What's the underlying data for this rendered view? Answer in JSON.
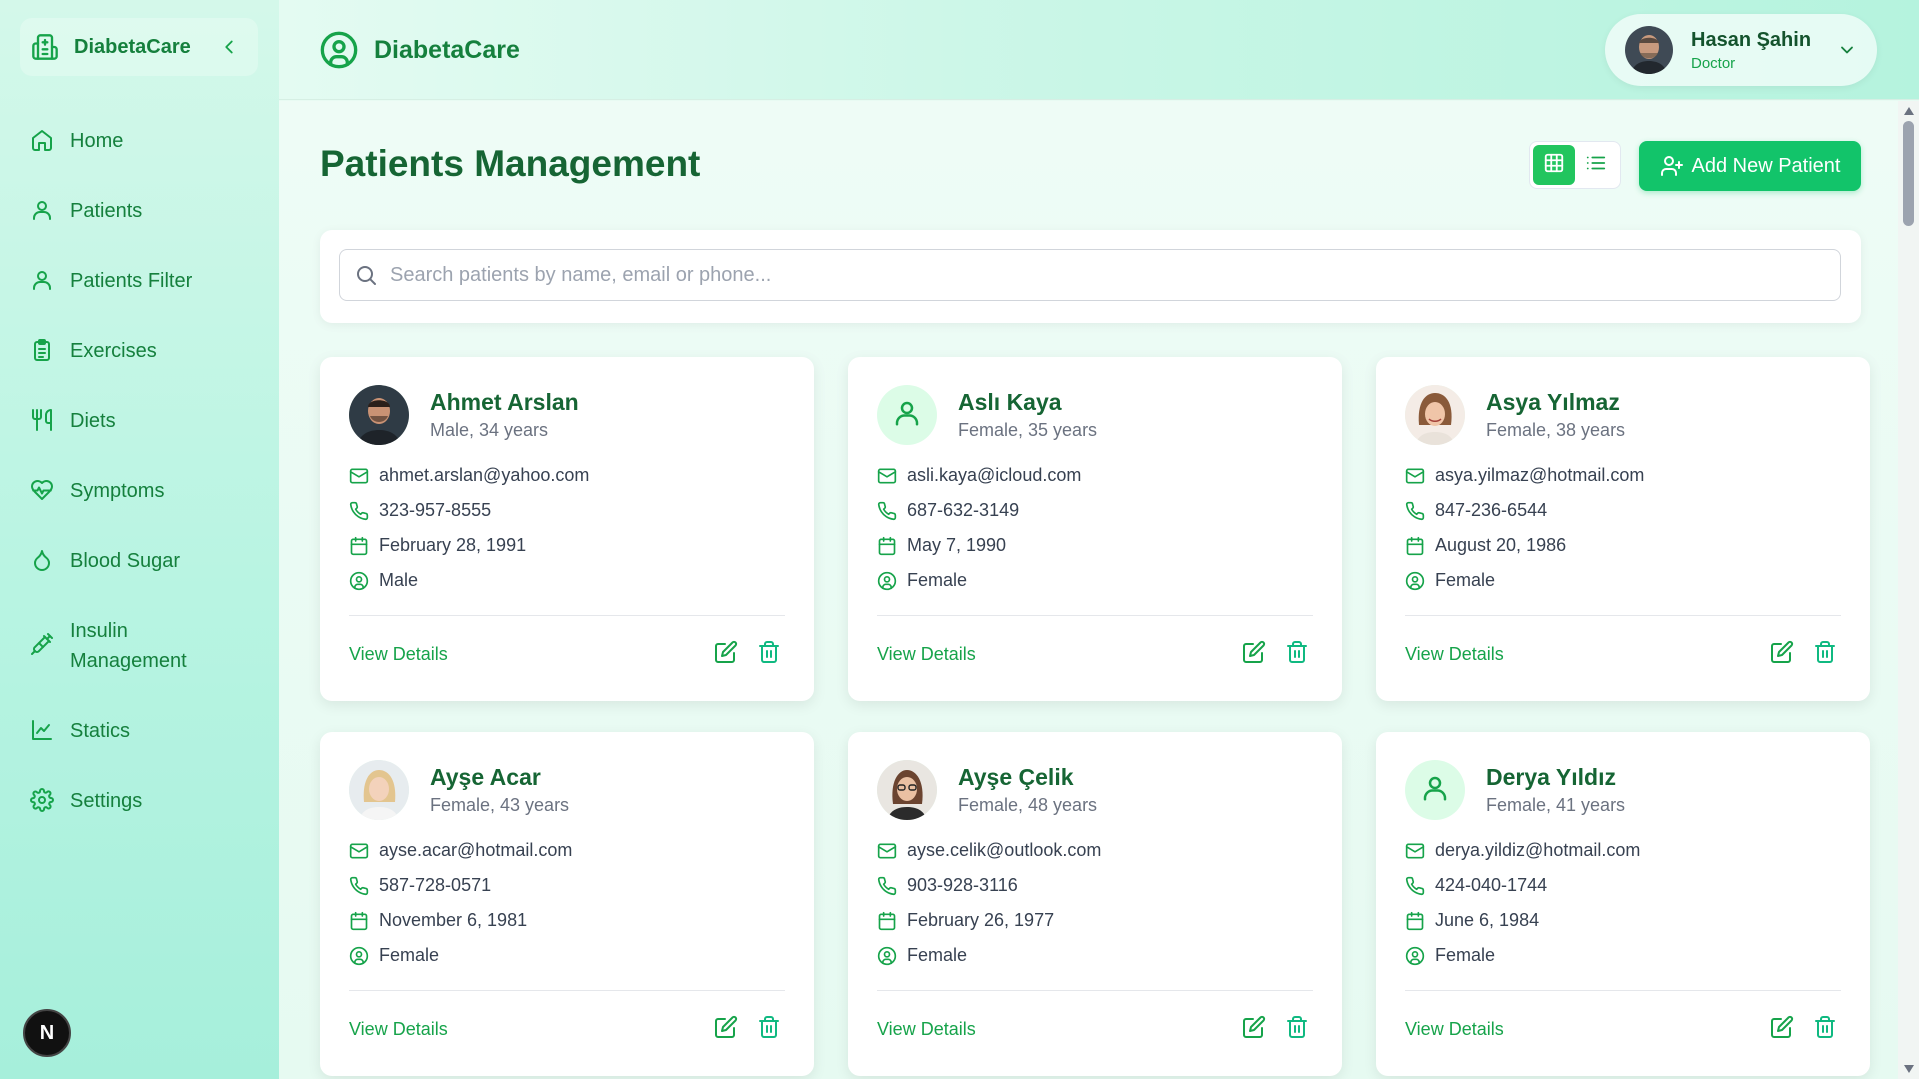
{
  "app": {
    "brand": "DiabetaCare",
    "accent": "#16a34a",
    "button_color": "#12c46a"
  },
  "sidebar": {
    "brand": "DiabetaCare",
    "items": [
      {
        "label": "Home",
        "icon": "home-icon"
      },
      {
        "label": "Patients",
        "icon": "user-icon"
      },
      {
        "label": "Patients Filter",
        "icon": "user-icon"
      },
      {
        "label": "Exercises",
        "icon": "clipboard-icon"
      },
      {
        "label": "Diets",
        "icon": "utensils-icon"
      },
      {
        "label": "Symptoms",
        "icon": "heart-pulse-icon"
      },
      {
        "label": "Blood Sugar",
        "icon": "droplet-icon"
      },
      {
        "label": "Insulin\nManagement",
        "icon": "syringe-icon"
      },
      {
        "label": "Statics",
        "icon": "line-chart-icon"
      },
      {
        "label": "Settings",
        "icon": "gear-icon"
      }
    ],
    "badge": "N"
  },
  "header": {
    "brand": "DiabetaCare",
    "user": {
      "name": "Hasan Şahin",
      "role": "Doctor"
    }
  },
  "main": {
    "title": "Patients Management",
    "add_button": "Add New Patient",
    "search_placeholder": "Search patients by name, email or phone...",
    "view_details": "View Details",
    "patients": [
      {
        "name": "Ahmet Arslan",
        "sub": "Male, 34 years",
        "email": "ahmet.arslan@yahoo.com",
        "phone": "323-957-8555",
        "birth": "February 28, 1991",
        "gender": "Male",
        "avatar": "photo"
      },
      {
        "name": "Aslı Kaya",
        "sub": "Female, 35 years",
        "email": "asli.kaya@icloud.com",
        "phone": "687-632-3149",
        "birth": "May 7, 1990",
        "gender": "Female",
        "avatar": "placeholder"
      },
      {
        "name": "Asya Yılmaz",
        "sub": "Female, 38 years",
        "email": "asya.yilmaz@hotmail.com",
        "phone": "847-236-6544",
        "birth": "August 20, 1986",
        "gender": "Female",
        "avatar": "photo"
      },
      {
        "name": "Ayşe Acar",
        "sub": "Female, 43 years",
        "email": "ayse.acar@hotmail.com",
        "phone": "587-728-0571",
        "birth": "November 6, 1981",
        "gender": "Female",
        "avatar": "photo"
      },
      {
        "name": "Ayşe Çelik",
        "sub": "Female, 48 years",
        "email": "ayse.celik@outlook.com",
        "phone": "903-928-3116",
        "birth": "February 26, 1977",
        "gender": "Female",
        "avatar": "photo"
      },
      {
        "name": "Derya Yıldız",
        "sub": "Female, 41 years",
        "email": "derya.yildiz@hotmail.com",
        "phone": "424-040-1744",
        "birth": "June 6, 1984",
        "gender": "Female",
        "avatar": "placeholder"
      }
    ]
  }
}
